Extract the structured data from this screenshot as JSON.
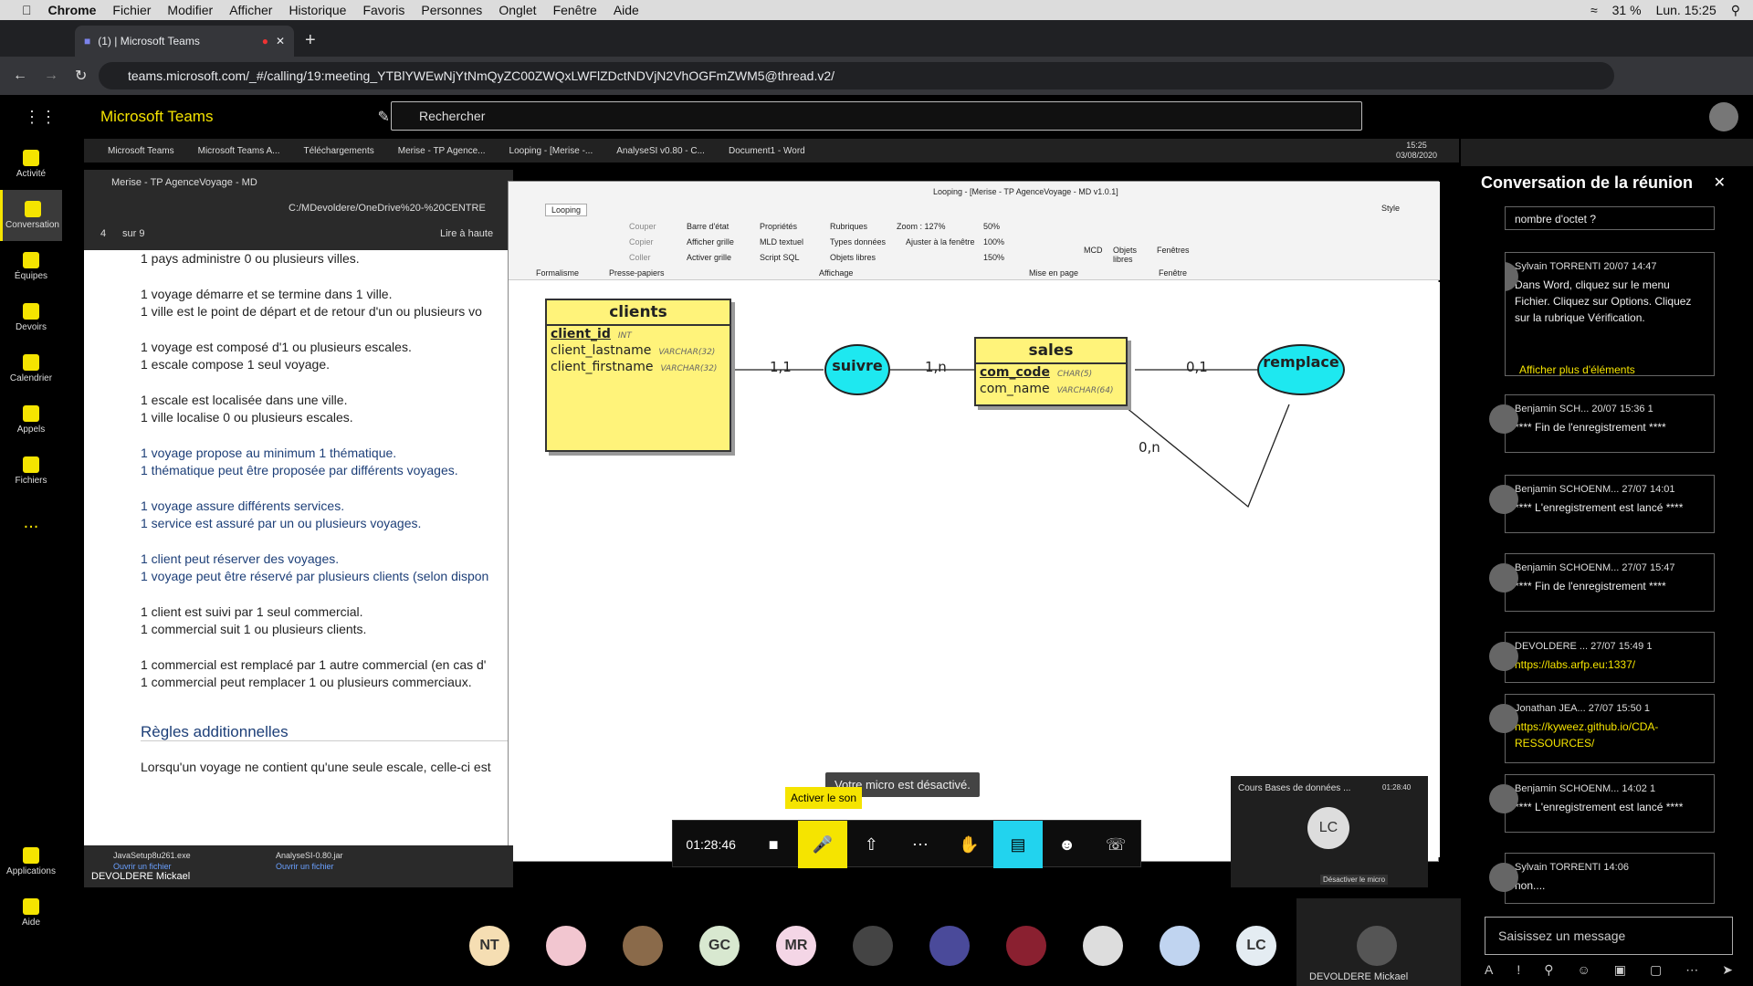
{
  "mac": {
    "app": "Chrome",
    "menus": [
      "Fichier",
      "Modifier",
      "Afficher",
      "Historique",
      "Favoris",
      "Personnes",
      "Onglet",
      "Fenêtre",
      "Aide"
    ],
    "battery": "31 %",
    "clock": "Lun. 15:25"
  },
  "browser": {
    "tab_title": "(1) | Microsoft Teams",
    "url": "teams.microsoft.com/_#/calling/19:meeting_YTBlYWEwNjYtNmQyZC00ZWQxLWFlZDctNDVjN2VhOGFmZWM5@thread.v2/"
  },
  "teams": {
    "title": "Microsoft Teams",
    "search_placeholder": "Rechercher",
    "rail": [
      "Activité",
      "Conversation",
      "Équipes",
      "Devoirs",
      "Calendrier",
      "Appels",
      "Fichiers",
      "...",
      "Applications",
      "Aide"
    ],
    "conversation_badge": "1"
  },
  "taskbar": {
    "items": [
      "Microsoft Teams",
      "Microsoft Teams A...",
      "Téléchargements",
      "Merise - TP Agence...",
      "Looping - [Merise -...",
      "AnalyseSI v0.80 - C...",
      "Document1 - Word"
    ],
    "time": "15:25",
    "date": "03/08/2020"
  },
  "pdf": {
    "tab": "Merise - TP AgenceVoyage - MD",
    "path": "C:/MDevoldere/OneDrive%20-%20CENTRE",
    "page": "4",
    "pages": "sur 9",
    "read": "Lire à haute",
    "lines": [
      "1 pays administre 0 ou plusieurs villes.",
      "1 voyage démarre et se termine dans 1 ville.",
      "1 ville est le point de départ et de retour d'un ou plusieurs vo",
      "1 voyage est composé d'1 ou plusieurs escales.",
      "1 escale compose 1 seul voyage.",
      "1 escale est localisée dans une ville.",
      "1 ville localise 0 ou plusieurs escales.",
      "1 voyage propose au minimum 1 thématique.",
      "1 thématique peut être proposée par différents voyages.",
      "1 voyage assure différents services.",
      "1 service est assuré par un ou plusieurs voyages.",
      "1 client peut réserver des voyages.",
      "1 voyage peut être réservé par plusieurs clients (selon dispon",
      "1 client est suivi par 1 seul commercial.",
      "1 commercial suit 1 ou plusieurs clients.",
      "1 commercial est remplacé par 1 autre commercial (en cas d'",
      "1 commercial peut remplacer 1 ou plusieurs commerciaux."
    ],
    "section": "Règles additionnelles",
    "last": "Lorsqu'un voyage ne contient qu'une seule escale, celle-ci est"
  },
  "looping": {
    "title": "Looping - [Merise - TP AgenceVoyage - MD v1.0.1]",
    "tab": "Looping",
    "groups": [
      "Formalisme",
      "Presse-papiers",
      "Affichage",
      "Mise en page",
      "Fenêtre"
    ],
    "clip": [
      "Couper",
      "Copier",
      "Coller"
    ],
    "display": [
      "Barre d'état",
      "Afficher grille",
      "Activer grille",
      "Propriétés",
      "MLD textuel",
      "Script SQL",
      "Rubriques",
      "Types données",
      "Objets libres"
    ],
    "zoom": "Zoom : 127%",
    "fit": "Ajuster à la fenêtre",
    "zoom_levels": [
      "50%",
      "100%",
      "150%"
    ],
    "style": "Style",
    "other": [
      "MCD",
      "Objets libres",
      "Fenêtres"
    ]
  },
  "mcd": {
    "clients": {
      "name": "clients",
      "fields": [
        {
          "n": "client_id",
          "t": "INT"
        },
        {
          "n": "client_lastname",
          "t": "VARCHAR(32)"
        },
        {
          "n": "client_firstname",
          "t": "VARCHAR(32)"
        }
      ]
    },
    "sales": {
      "name": "sales",
      "fields": [
        {
          "n": "com_code",
          "t": "CHAR(5)"
        },
        {
          "n": "com_name",
          "t": "VARCHAR(64)"
        }
      ]
    },
    "suivre": "suivre",
    "remplace": "remplace",
    "cards": [
      "1,1",
      "1,n",
      "0,1",
      "0,n"
    ]
  },
  "call": {
    "timer": "01:28:46",
    "tooltip": "Activer le son",
    "muted": "Votre micro est désactivé.",
    "mini_title": "Cours Bases de données ...",
    "mini_time": "01:28:40",
    "mini_user": "LC",
    "unmute_tip": "Désactiver le micro"
  },
  "chat": {
    "title": "Conversation de la réunion",
    "input": "Saisissez un message",
    "more": "Afficher plus d'éléments",
    "top": "nombre d'octet ?",
    "messages": [
      {
        "who": "Sylvain TORRENTI",
        "time": "20/07 14:47",
        "text": "Dans Word, cliquez sur le menu Fichier. Cliquez sur Options. Cliquez sur la rubrique Vérification."
      },
      {
        "who": "Benjamin SCH...",
        "time": "20/07 15:36",
        "likes": "1",
        "text": "**** Fin de l'enregistrement ****"
      },
      {
        "who": "Benjamin SCHOENM...",
        "time": "27/07 14:01",
        "text": "**** L'enregistrement est lancé ****"
      },
      {
        "who": "Benjamin SCHOENM...",
        "time": "27/07 15:47",
        "text": "**** Fin de l'enregistrement ****"
      },
      {
        "who": "DEVOLDERE ...",
        "time": "27/07 15:49",
        "likes": "1",
        "text": "https://labs.arfp.eu:1337/"
      },
      {
        "who": "Jonathan JEA...",
        "time": "27/07 15:50",
        "likes": "1",
        "text": "https://kyweez.github.io/CDA-RESSOURCES/"
      },
      {
        "who": "Benjamin SCHOENM...",
        "time": "14:02",
        "likes": "1",
        "text": "**** L'enregistrement est lancé ****"
      },
      {
        "who": "Sylvain TORRENTI",
        "time": "14:06",
        "text": "non...."
      }
    ]
  },
  "downloads": [
    {
      "name": "JavaSetup8u261.exe",
      "action": "Ouvrir un fichier"
    },
    {
      "name": "AnalyseSI-0.80.jar",
      "action": "Ouvrir un fichier"
    }
  ],
  "presenter": "DEVOLDERE Mickael",
  "participants": [
    "NT",
    "",
    "",
    "GC",
    "MR",
    "",
    "",
    "",
    "",
    "",
    "LC"
  ]
}
